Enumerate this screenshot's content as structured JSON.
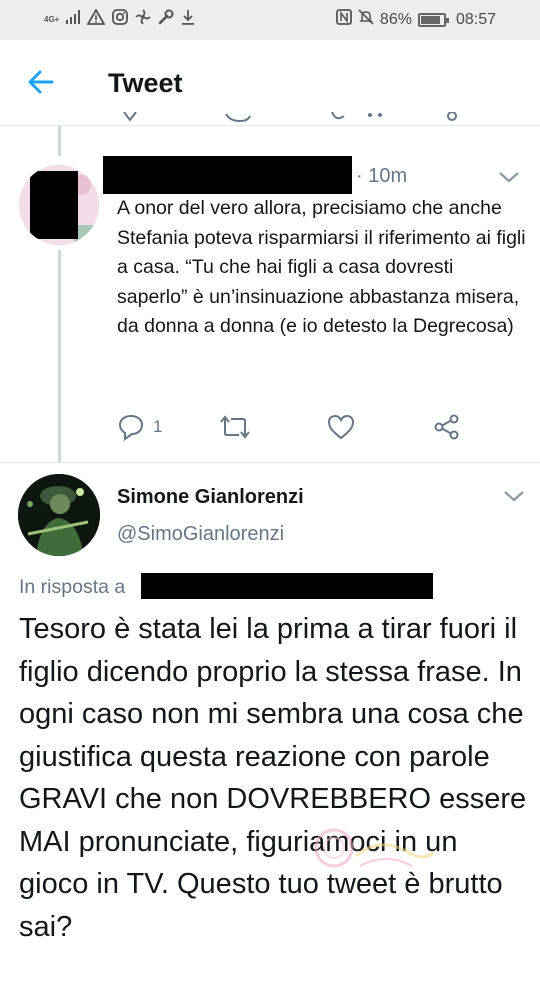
{
  "status_bar": {
    "network": "4G+",
    "battery_percent": "86%",
    "battery_level": 0.86,
    "time": "08:57",
    "left_icons": [
      "signal-icon",
      "warning-icon",
      "instagram-icon",
      "fan-icon",
      "wrench-icon",
      "download-icon"
    ],
    "right_icons": [
      "nfc-icon",
      "mute-icon",
      "battery-icon"
    ]
  },
  "header": {
    "title": "Tweet",
    "back_icon": "arrow-left-icon"
  },
  "reply_tweet": {
    "time": "· 10m",
    "text": "A onor del vero allora, precisiamo che anche Stefania poteva risparmiarsi il riferimento ai figli a casa. “Tu che hai figli a casa dovresti saperlo” è un’insinuazione abbastanza misera, da donna a donna (e io detesto la Degrecosa)",
    "reply_count": "1"
  },
  "main_tweet": {
    "display_name": "Simone Gianlorenzi",
    "handle": "@SimoGianlorenzi",
    "in_reply_to_label": "In risposta a",
    "text": "Tesoro è stata lei la prima a tirar fuori il figlio dicendo proprio la stessa frase. In ogni caso non mi sembra una cosa che giustifica questa reazione con parole GRAVI che non DOVREBBERO essere MAI pronunciate, figuriamoci in un gioco in TV. Questo tuo tweet è brutto sai?"
  },
  "colors": {
    "accent": "#1da1f2",
    "secondary_text": "#657786",
    "primary_text": "#14171a",
    "divider": "#e1e8ed",
    "status_bar_bg": "#ededed"
  }
}
